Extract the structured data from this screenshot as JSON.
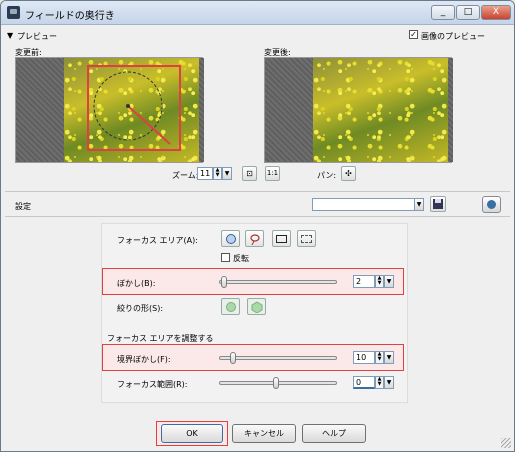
{
  "window": {
    "title": "フィールドの奥行き"
  },
  "title_buttons": {
    "minimize": "_",
    "maximize": "□",
    "close": "X"
  },
  "preview": {
    "section_label": "プレビュー",
    "show_preview_label": "画像のプレビュー",
    "show_preview_checked": "✓",
    "before_label": "変更前:",
    "after_label": "変更後:"
  },
  "zoom": {
    "label": "ズーム:",
    "value": "11",
    "actual_size_label": "1:1",
    "pan_label": "パン:"
  },
  "settings": {
    "label": "設定",
    "preset_value": ""
  },
  "focus": {
    "area_label": "フォーカス エリア(A):",
    "invert_label": "反転",
    "blur_label": "ぼかし(B):",
    "blur_value": "2",
    "aperture_label": "絞りの形(S):",
    "adjust_header": "フォーカス エリアを調整する",
    "edge_blur_label": "境界ぼかし(F):",
    "edge_blur_value": "10",
    "range_label": "フォーカス範囲(R):",
    "range_value": "0"
  },
  "sliders": {
    "blur_level": 0.02,
    "edge_blur_level": 0.1,
    "range_level": 0.48
  },
  "buttons": {
    "ok": "OK",
    "cancel": "キャンセル",
    "help": "ヘルプ"
  },
  "colors": {
    "highlight": "#e04040",
    "accent": "#3a6ea5"
  }
}
